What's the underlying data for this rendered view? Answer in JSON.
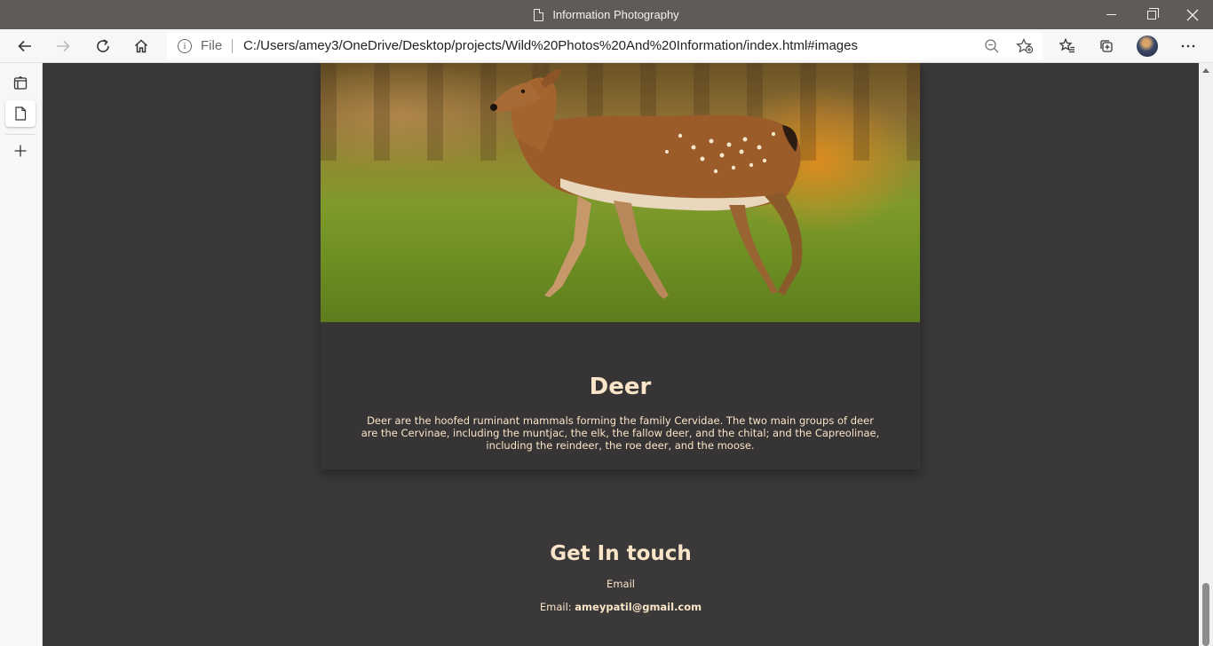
{
  "window": {
    "title": "Information Photography"
  },
  "toolbar": {
    "address_prefix": "File",
    "url": "C:/Users/amey3/OneDrive/Desktop/projects/Wild%20Photos%20And%20Information/index.html#images"
  },
  "icons": {
    "back": "back-arrow-icon",
    "forward": "forward-arrow-icon",
    "refresh": "refresh-icon",
    "home": "home-icon",
    "info": "info-icon",
    "zoom": "zoom-out-icon",
    "add_favorite": "add-favorite-icon",
    "favorites": "favorites-icon",
    "collections": "collections-icon",
    "more": "more-icon"
  },
  "card": {
    "title": "Deer",
    "description": "Deer are the hoofed ruminant mammals forming the family Cervidae. The two main groups of deer are the Cervinae, including the muntjac, the elk, the fallow deer, and the chital; and the Capreolinae, including the reindeer, the roe deer, and the moose."
  },
  "contact": {
    "title": "Get In touch",
    "label": "Email",
    "email_prefix": "Email:",
    "email": "ameypatil@gmail.com"
  },
  "colors": {
    "page_bg": "#3a3838",
    "card_bg": "#363434",
    "text": "#fbe5c8",
    "titlebar": "#5f5b59"
  }
}
